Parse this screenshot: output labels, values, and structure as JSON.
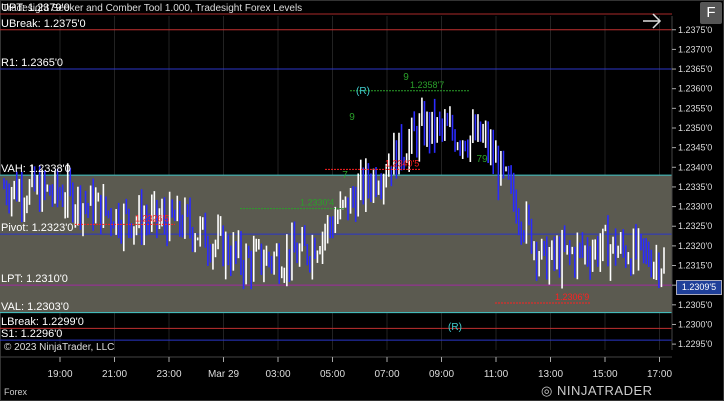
{
  "window": {
    "title": "Tradesight Seeker and Comber Tool 1.000, Tradesight Forex Levels",
    "copyright": "© 2023 NinjaTrader, LLC",
    "tab_label": "Forex",
    "logo_text": "NINJATRADER",
    "f_button": "F"
  },
  "levels": [
    {
      "label": "UPT: 1.2379'0",
      "price": 1.2379,
      "color": "#aa2a2a"
    },
    {
      "label": "UBreak: 1.2375'0",
      "price": 1.2375,
      "color": "#c03030"
    },
    {
      "label": "R1: 1.2365'0",
      "price": 1.2365,
      "color": "#2b36c8"
    },
    {
      "label": "VAH: 1.2338'0",
      "price": 1.2338,
      "color": "#40c8c8"
    },
    {
      "label": "Pivot: 1.2323'0",
      "price": 1.2323,
      "color": "#2b36c8"
    },
    {
      "label": "LPT: 1.2310'0",
      "price": 1.231,
      "color": "#a02aa0"
    },
    {
      "label": "VAL: 1.2303'0",
      "price": 1.2303,
      "color": "#40c8c8"
    },
    {
      "label": "LBreak: 1.2299'0",
      "price": 1.2299,
      "color": "#c03030"
    },
    {
      "label": "S1: 1.2296'0",
      "price": 1.2296,
      "color": "#2b36c8"
    }
  ],
  "annotations": [
    {
      "text": "1.2358'7",
      "color": "#2aa02a",
      "price": 1.2361
    },
    {
      "text": "1.2340'5",
      "color": "#ff2020",
      "price": 1.2341
    },
    {
      "text": "1.2330'4",
      "color": "#2aa02a",
      "price": 1.2331
    },
    {
      "text": "1.2326'5",
      "color": "#ff2020",
      "price": 1.2327
    },
    {
      "text": "1.2306'9",
      "color": "#ff2020",
      "price": 1.2307
    }
  ],
  "markers": [
    {
      "text": "(R)",
      "color": "#40d0d0"
    },
    {
      "text": "(R)",
      "color": "#40d0d0"
    },
    {
      "text": "9",
      "color": "#2aa02a"
    },
    {
      "text": "9",
      "color": "#2aa02a"
    },
    {
      "text": "79",
      "color": "#2aa02a"
    },
    {
      "text": "7",
      "color": "#2aa02a"
    }
  ],
  "current_price": "1.2309'5",
  "y_axis": {
    "min": 1.22935,
    "max": 1.23785,
    "ticks": [
      "1.2375'0",
      "1.2370'0",
      "1.2365'0",
      "1.2360'0",
      "1.2355'0",
      "1.2350'0",
      "1.2345'0",
      "1.2340'0",
      "1.2335'0",
      "1.2330'0",
      "1.2325'0",
      "1.2320'0",
      "1.2315'0",
      "1.2310'0",
      "1.2305'0",
      "1.2300'0",
      "1.2295'0"
    ],
    "tick_values": [
      1.2375,
      1.237,
      1.2365,
      1.236,
      1.2355,
      1.235,
      1.2345,
      1.234,
      1.2335,
      1.233,
      1.2325,
      1.232,
      1.2315,
      1.231,
      1.2305,
      1.23,
      1.2295
    ]
  },
  "x_axis": {
    "ticks": [
      "19:00",
      "21:00",
      "23:00",
      "Mar 29",
      "03:00",
      "05:00",
      "07:00",
      "09:00",
      "11:00",
      "13:00",
      "15:00",
      "17:00"
    ]
  },
  "colors": {
    "value_area": "#5b5a50",
    "up_bar": "#ffffff",
    "down_bar": "#2b2bff",
    "grid": "#222"
  },
  "chart_data": {
    "type": "line",
    "title": "Tradesight Seeker and Comber Tool 1.000, Tradesight Forex Levels",
    "xlabel": "",
    "ylabel": "",
    "ylim": [
      1.22935,
      1.23785
    ],
    "categories": [
      "19:00",
      "21:00",
      "23:00",
      "Mar 29",
      "03:00",
      "05:00",
      "07:00",
      "09:00",
      "11:00",
      "13:00",
      "15:00",
      "17:00"
    ],
    "series": [
      {
        "values": [
          1.2335,
          1.2333,
          1.2327,
          1.2326,
          1.2316,
          1.2318,
          1.2335,
          1.235,
          1.2347,
          1.2316,
          1.232,
          1.2316
        ]
      }
    ]
  }
}
